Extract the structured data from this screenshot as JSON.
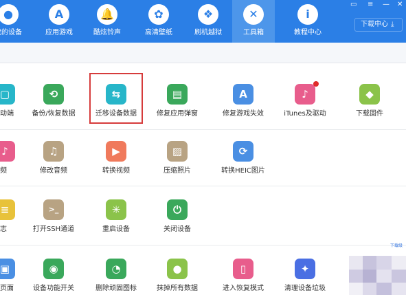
{
  "nav": {
    "items": [
      {
        "label": "我的设备",
        "icon": "apple-icon"
      },
      {
        "label": "应用游戏",
        "icon": "app-store-icon"
      },
      {
        "label": "酷炫铃声",
        "icon": "bell-icon"
      },
      {
        "label": "高清壁纸",
        "icon": "flower-icon"
      },
      {
        "label": "刷机越狱",
        "icon": "dropbox-icon"
      },
      {
        "label": "工具箱",
        "icon": "tools-icon"
      },
      {
        "label": "教程中心",
        "icon": "info-icon"
      }
    ],
    "download_label": "下载中心",
    "colors": {
      "bar": "#2b7fe6",
      "active": "#4d96ea"
    }
  },
  "rows": [
    {
      "items": [
        {
          "label": "动端",
          "color": "#27b6c9",
          "glyph": "▢"
        },
        {
          "label": "备份/恢复数据",
          "color": "#3aa85b",
          "glyph": "⟲"
        },
        {
          "label": "迁移设备数据",
          "color": "#27b6c9",
          "glyph": "⇆"
        },
        {
          "label": "修复应用弹窗",
          "color": "#3aa85b",
          "glyph": "▤"
        },
        {
          "label": "修复游戏失效",
          "color": "#4a8fe3",
          "glyph": "A"
        },
        {
          "label": "iTunes及驱动",
          "color": "#e85d8c",
          "glyph": "♪"
        },
        {
          "label": "下载固件",
          "color": "#8bc34a",
          "glyph": "◆"
        }
      ]
    },
    {
      "items": [
        {
          "label": "频",
          "color": "#e85d8c",
          "glyph": "♪"
        },
        {
          "label": "修改音频",
          "color": "#b8a383",
          "glyph": "♫"
        },
        {
          "label": "转换视频",
          "color": "#f07a5c",
          "glyph": "▶"
        },
        {
          "label": "压缩照片",
          "color": "#b8a383",
          "glyph": "▨"
        },
        {
          "label": "转换HEIC图片",
          "color": "#4a8fe3",
          "glyph": "⟳"
        }
      ]
    },
    {
      "items": [
        {
          "label": "志",
          "color": "#e8c23a",
          "glyph": "≡"
        },
        {
          "label": "打开SSH通道",
          "color": "#b8a383",
          "glyph": ">_"
        },
        {
          "label": "重启设备",
          "color": "#8bc34a",
          "glyph": "✳"
        },
        {
          "label": "关闭设备",
          "color": "#3aa85b",
          "glyph": "⏻"
        }
      ]
    },
    {
      "items": [
        {
          "label": "页面",
          "color": "#4a8fe3",
          "glyph": "▣"
        },
        {
          "label": "设备功能开关",
          "color": "#3aa85b",
          "glyph": "◉"
        },
        {
          "label": "删除顽固图标",
          "color": "#3aa85b",
          "glyph": "◔"
        },
        {
          "label": "抹掉所有数据",
          "color": "#8bc34a",
          "glyph": "●"
        },
        {
          "label": "进入恢复模式",
          "color": "#e85d8c",
          "glyph": "▯"
        },
        {
          "label": "清理设备垃圾",
          "color": "#4a6fe3",
          "glyph": "✦"
        }
      ]
    }
  ],
  "corner_text": "下载级"
}
